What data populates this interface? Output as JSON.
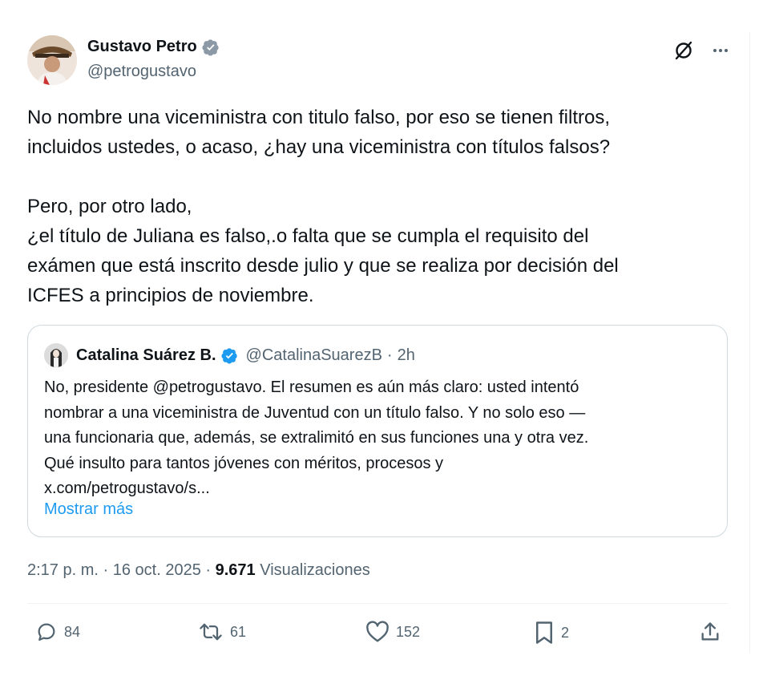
{
  "author": {
    "name": "Gustavo Petro",
    "handle": "@petrogustavo"
  },
  "tweet": {
    "lines_p1": [
      "No nombre una viceministra con titulo falso, por eso se tienen filtros,",
      "incluidos ustedes, o acaso, ¿hay una viceministra con títulos falsos?"
    ],
    "lines_p2": [
      "Pero, por otro lado,",
      "¿el título de Juliana  es falso,.o falta que se cumpla el requisito del",
      "exámen que está inscrito desde julio y que se realiza por decisión del",
      "ICFES a principios de noviembre."
    ]
  },
  "quote": {
    "name": "Catalina Suárez B.",
    "handle": "@CatalinaSuarezB",
    "separator": "·",
    "time": "2h",
    "lines": [
      "No, presidente @petrogustavo. El resumen es aún más claro: usted intentó",
      "nombrar a una viceministra de Juventud con un título falso. Y no solo eso —",
      "una funcionaria que, además, se extralimitó en sus funciones una y otra vez.",
      "Qué insulto para tantos jóvenes con méritos, procesos y",
      "x.com/petrogustavo/s..."
    ],
    "show_more": "Mostrar más"
  },
  "meta": {
    "time": "2:17 p. m.",
    "sep1": "·",
    "date": "16 oct. 2025",
    "sep2": "·",
    "views": "9.671",
    "views_label": "Visualizaciones"
  },
  "actions": {
    "replies": "84",
    "reposts": "61",
    "likes": "152",
    "bookmarks": "2"
  },
  "colors": {
    "text": "#0f1419",
    "secondary": "#536471",
    "accent": "#1d9bf0",
    "verified": "#8b98a5",
    "quote_verified": "#1d9bf0"
  },
  "icons": [
    "grok-icon",
    "more-icon",
    "verified-gray-icon",
    "verified-blue-icon",
    "reply-icon",
    "repost-icon",
    "like-icon",
    "bookmark-icon",
    "share-icon"
  ]
}
